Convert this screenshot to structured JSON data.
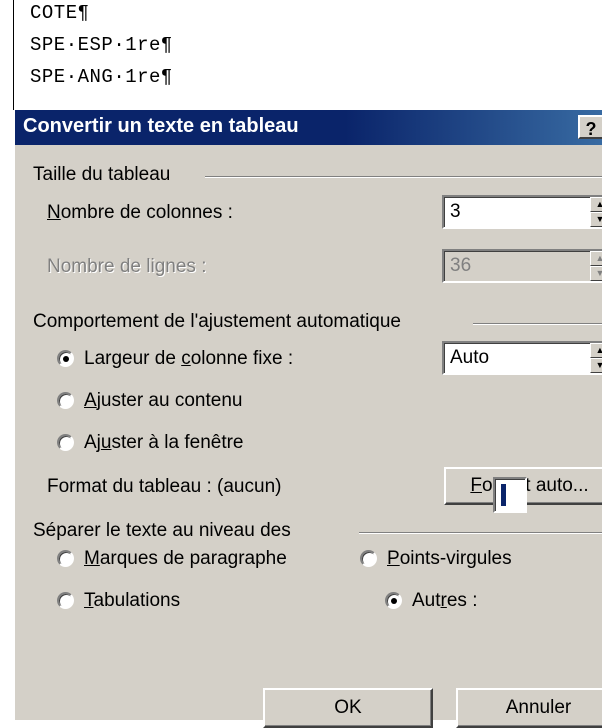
{
  "document": {
    "lines": [
      "COTE¶",
      "SPE·ESP·1re¶",
      "SPE·ANG·1re¶"
    ]
  },
  "dialog": {
    "title": "Convertir un texte en tableau",
    "help_label": "?",
    "table_size": {
      "group_label": "Taille du tableau",
      "columns_label_u": "N",
      "columns_label_rest": "ombre de colonnes :",
      "columns_value": "3",
      "rows_label": "Nombre de lignes :",
      "rows_value": "36"
    },
    "autofit": {
      "group_label": "Comportement de l'ajustement automatique",
      "fixed_width_pre": "Largeur de ",
      "fixed_width_u": "c",
      "fixed_width_post": "olonne fixe :",
      "fixed_width_value": "Auto",
      "fit_contents_u": "A",
      "fit_contents_rest": "juster au contenu",
      "fit_window_pre": "Aj",
      "fit_window_u": "u",
      "fit_window_post": "ster à la fenêtre",
      "format_label": "Format du tableau : (aucun)",
      "format_button_u": "F",
      "format_button_rest": "ormat auto..."
    },
    "separator": {
      "group_label": "Séparer le texte au niveau des",
      "paragraphs_u": "M",
      "paragraphs_rest": "arques de paragraphe",
      "semicolons_u": "P",
      "semicolons_rest": "oints-virgules",
      "tabs_u": "T",
      "tabs_rest": "abulations",
      "other_pre": "Aut",
      "other_u": "r",
      "other_post": "es :"
    },
    "ok_label": "OK",
    "cancel_label": "Annuler"
  }
}
